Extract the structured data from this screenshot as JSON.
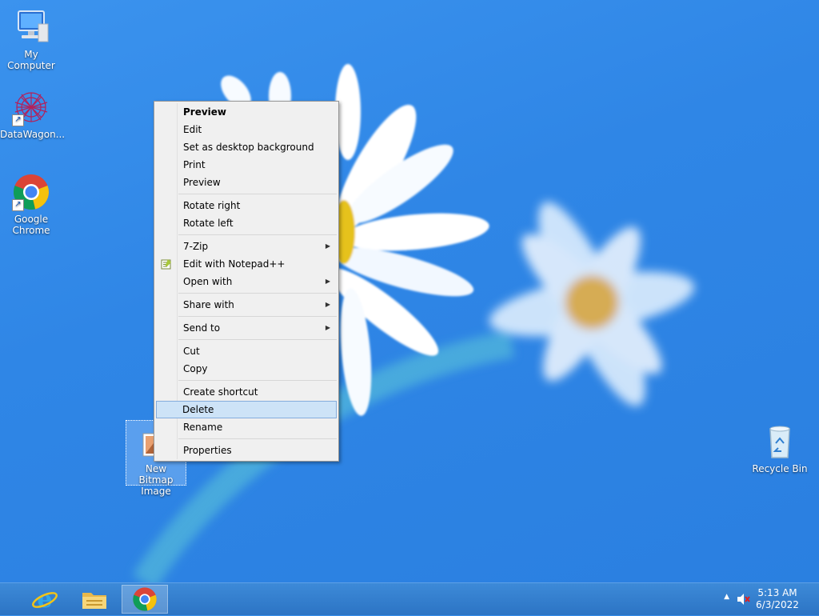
{
  "desktop": {
    "icons": [
      {
        "label": "My Computer",
        "icon": "computer-icon"
      },
      {
        "label": "DataWagon...",
        "icon": "datawagon-icon"
      },
      {
        "label": "Google Chrome",
        "icon": "chrome-icon"
      },
      {
        "label": "New Bitmap Image",
        "icon": "bitmap-image-icon"
      },
      {
        "label": "Recycle Bin",
        "icon": "recycle-bin-icon"
      }
    ]
  },
  "context_menu": {
    "items": [
      {
        "label": "Preview",
        "bold": true
      },
      {
        "label": "Edit"
      },
      {
        "label": "Set as desktop background"
      },
      {
        "label": "Print"
      },
      {
        "label": "Preview"
      },
      {
        "label": "Rotate right"
      },
      {
        "label": "Rotate left"
      },
      {
        "label": "7-Zip",
        "submenu": true
      },
      {
        "label": "Edit with Notepad++",
        "icon": "notepad-plus-icon"
      },
      {
        "label": "Open with",
        "submenu": true
      },
      {
        "label": "Share with",
        "submenu": true
      },
      {
        "label": "Send to",
        "submenu": true
      },
      {
        "label": "Cut"
      },
      {
        "label": "Copy"
      },
      {
        "label": "Create shortcut"
      },
      {
        "label": "Delete",
        "highlighted": true
      },
      {
        "label": "Rename"
      },
      {
        "label": "Properties"
      }
    ]
  },
  "taskbar": {
    "pinned": [
      "internet-explorer-icon",
      "file-explorer-icon",
      "chrome-icon"
    ],
    "clock": {
      "time": "5:13 AM",
      "date": "6/3/2022"
    }
  },
  "colors": {
    "desktop_blue": "#2f86e6",
    "menu_bg": "#f0f0f0",
    "menu_highlight": "#cde3f7",
    "taskbar": "#2c74c4"
  }
}
